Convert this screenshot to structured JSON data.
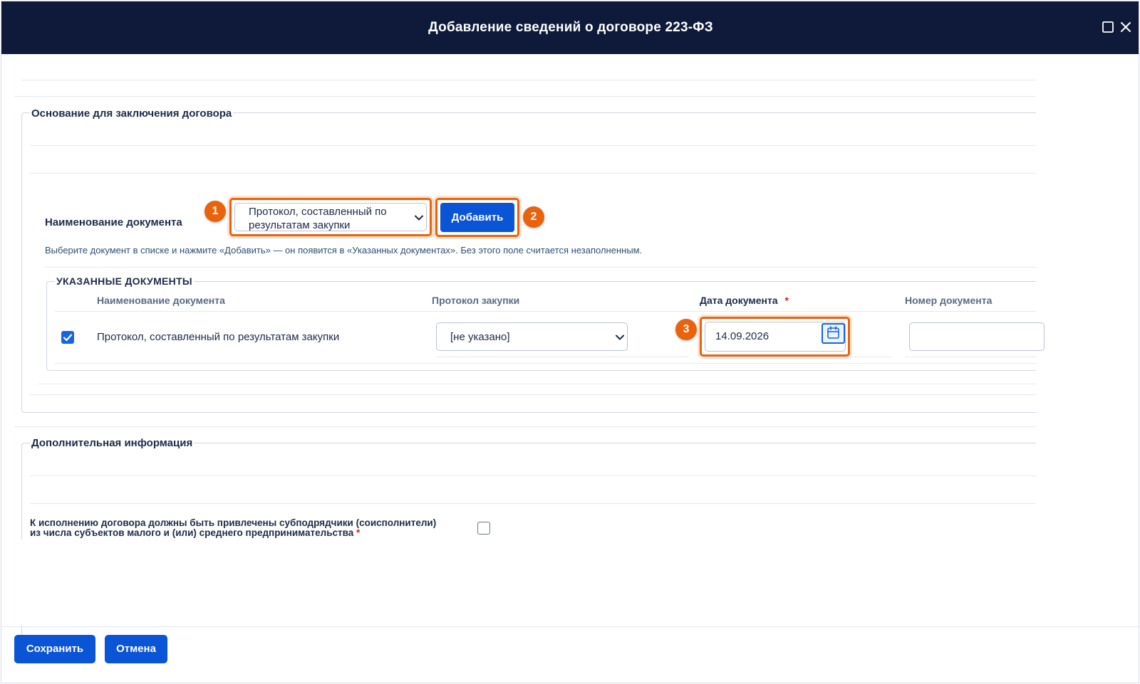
{
  "header": {
    "title": "Добавление сведений о договоре 223-ФЗ"
  },
  "section_basis": {
    "legend": "Основание для заключения договора",
    "doc_name_label": "Наименование документа",
    "doc_select_value_line1": "Протокол, составленный по",
    "doc_select_value_line2": "результатам закупки",
    "add_button": "Добавить",
    "hint": "Выберите документ в списке и нажмите «Добавить» — он появится в «Указанных документах». Без этого поле считается незаполненным.",
    "badges": [
      "1",
      "2",
      "3"
    ]
  },
  "documents_table": {
    "legend": "УКАЗАННЫЕ ДОКУМЕНТЫ",
    "columns": [
      "Наименование документа",
      "Протокол закупки",
      "Дата документа",
      "Номер документа"
    ],
    "required_mark": "*",
    "rows": [
      {
        "checked": true,
        "name": "Протокол, составленный по результатам закупки",
        "protocol": "[не указано]",
        "date": "14.09.2026",
        "number": ""
      }
    ]
  },
  "section_additional": {
    "legend": "Дополнительная информация",
    "subcontractors_line1": "К исполнению договора должны быть привлечены субподрядчики (соисполнители)",
    "subcontractors_line2": "из числа субъектов малого и (или) среднего предпринимательства",
    "required_mark": "*",
    "subcontractors_checked": false
  },
  "footer": {
    "save_button": "Сохранить",
    "cancel_button": "Отмена"
  },
  "colors": {
    "header_bg": "#0f1a3b",
    "primary": "#0a54d6",
    "highlight": "#e8630c",
    "required": "#d0202a"
  },
  "icons": [
    "maximize-icon",
    "close-icon",
    "chevron-down-icon",
    "calendar-icon",
    "checkmark-icon"
  ]
}
